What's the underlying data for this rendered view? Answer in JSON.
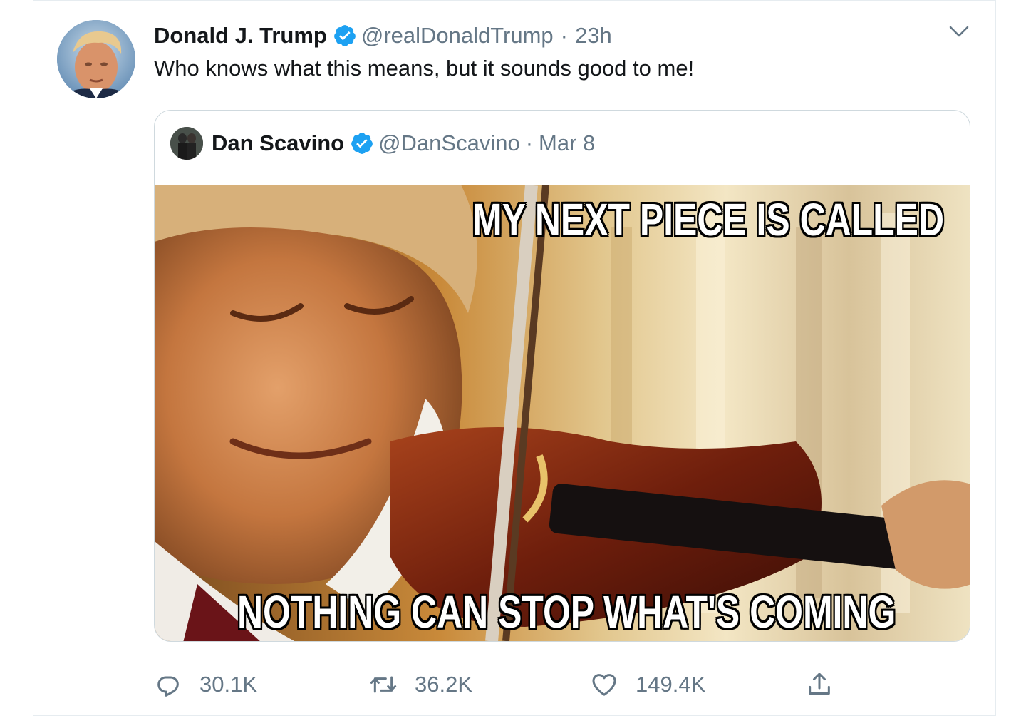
{
  "tweet": {
    "author_name": "Donald J. Trump",
    "author_handle": "@realDonaldTrump",
    "separator": "·",
    "time": "23h",
    "text": "Who knows what this means, but it sounds good to me!"
  },
  "quoted_tweet": {
    "author_name": "Dan Scavino",
    "author_handle": "@DanScavino",
    "separator": "·",
    "date": "Mar 8",
    "meme_top_text": "MY NEXT PIECE IS CALLED",
    "meme_bottom_text": "NOTHING CAN STOP WHAT'S COMING"
  },
  "actions": {
    "replies": "30.1K",
    "retweets": "36.2K",
    "likes": "149.4K"
  },
  "icons": {
    "verified": "verified-badge-icon",
    "caret": "chevron-down-icon",
    "reply": "reply-icon",
    "retweet": "retweet-icon",
    "like": "heart-icon",
    "share": "share-icon"
  },
  "colors": {
    "accent": "#1da1f2",
    "secondary_text": "#657786",
    "primary_text": "#14171a",
    "border": "#cfd9de"
  }
}
